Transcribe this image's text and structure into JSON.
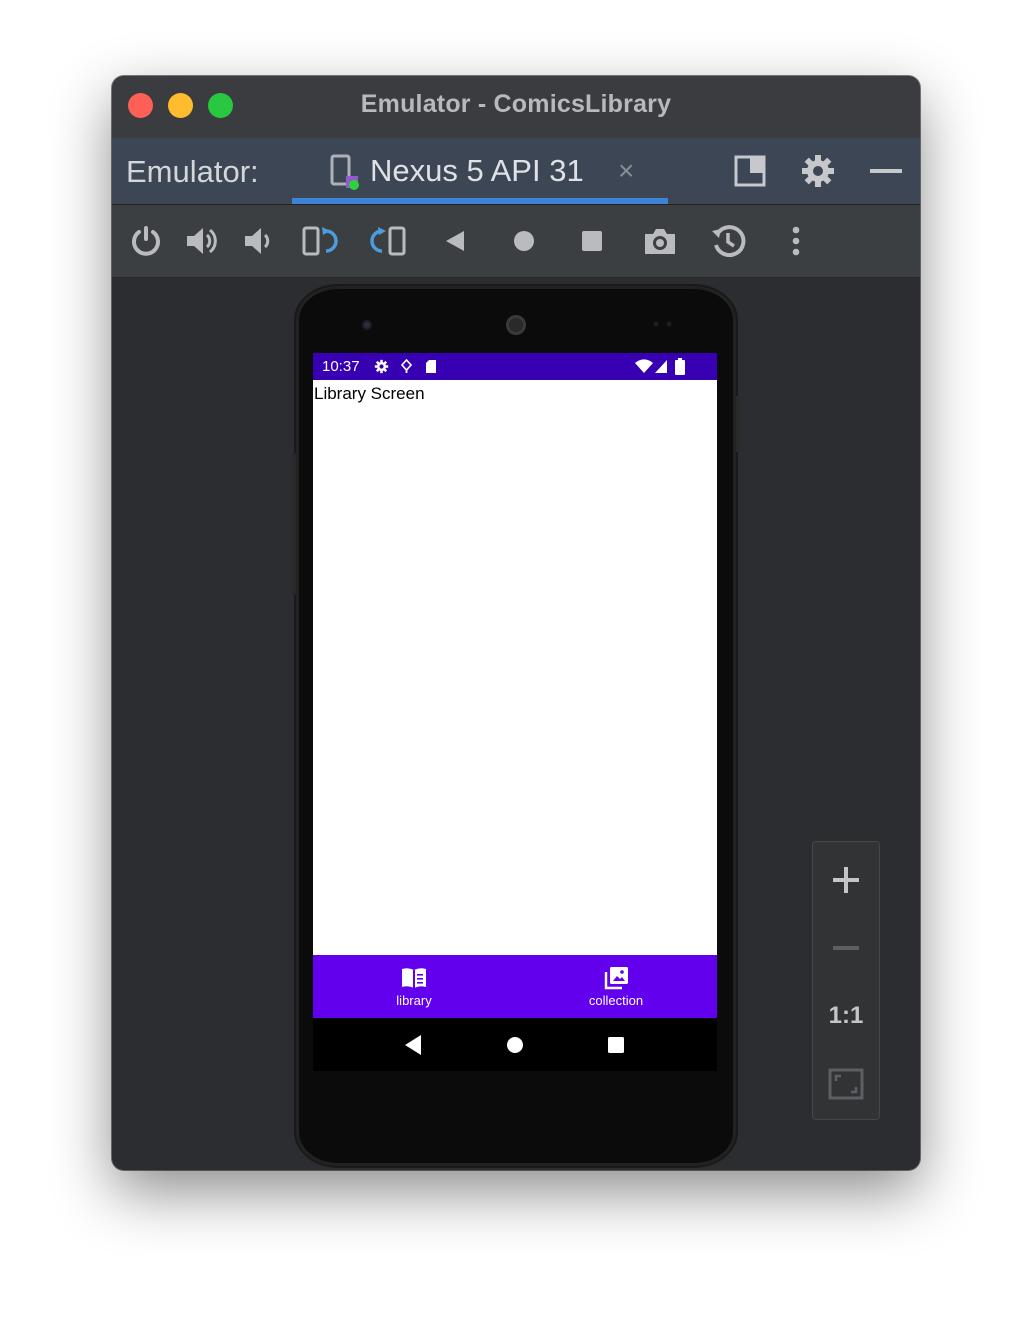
{
  "window": {
    "title": "Emulator - ComicsLibrary"
  },
  "tabbar": {
    "label": "Emulator:",
    "tab_label": "Nexus 5 API 31",
    "tab_close": "×"
  },
  "toolbar": {
    "tools": [
      "power-icon",
      "volume-up-icon",
      "volume-down-icon",
      "rotate-left-icon",
      "rotate-right-icon",
      "back-icon",
      "home-icon",
      "overview-icon",
      "camera-icon",
      "snapshot-icon",
      "more-icon"
    ]
  },
  "device": {
    "status_time": "10:37",
    "content_text": "Library Screen",
    "nav": [
      {
        "label": "library",
        "icon": "book-icon"
      },
      {
        "label": "collection",
        "icon": "collection-icon"
      }
    ],
    "status_bar_color": "#3700b3",
    "nav_bar_color": "#6200ee"
  },
  "zoom": {
    "one_to_one": "1:1"
  }
}
